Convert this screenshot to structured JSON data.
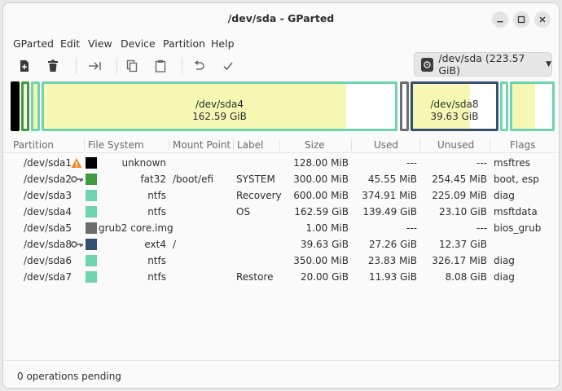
{
  "window": {
    "title": "/dev/sda - GParted"
  },
  "menu": [
    "GParted",
    "Edit",
    "View",
    "Device",
    "Partition",
    "Help"
  ],
  "toolbar": {
    "icons": [
      "new-partition-icon",
      "delete-icon",
      "resize-move-icon",
      "copy-icon",
      "paste-icon",
      "undo-icon",
      "apply-icon"
    ]
  },
  "device_selector": {
    "label": "/dev/sda (223.57 GiB)"
  },
  "disk_graph": {
    "sda4": {
      "line1": "/dev/sda4",
      "line2": "162.59 GiB"
    },
    "sda8": {
      "line1": "/dev/sda8",
      "line2": "39.63 GiB"
    }
  },
  "table": {
    "columns": [
      "Partition",
      "File System",
      "Mount Point",
      "Label",
      "Size",
      "Used",
      "Unused",
      "Flags"
    ],
    "rows": [
      {
        "partition": "/dev/sda1",
        "warning": true,
        "key": false,
        "color": "#000000",
        "filesystem": "unknown",
        "mount": "",
        "label": "",
        "size": "128.00 MiB",
        "used": "---",
        "unused": "---",
        "flags": "msftres"
      },
      {
        "partition": "/dev/sda2",
        "warning": false,
        "key": true,
        "color": "#3f9b3f",
        "filesystem": "fat32",
        "mount": "/boot/efi",
        "label": "SYSTEM",
        "size": "300.00 MiB",
        "used": "45.55 MiB",
        "unused": "254.45 MiB",
        "flags": "boot, esp"
      },
      {
        "partition": "/dev/sda3",
        "warning": false,
        "key": false,
        "color": "#6fd3b0",
        "filesystem": "ntfs",
        "mount": "",
        "label": "Recovery",
        "size": "600.00 MiB",
        "used": "374.91 MiB",
        "unused": "225.09 MiB",
        "flags": "diag"
      },
      {
        "partition": "/dev/sda4",
        "warning": false,
        "key": false,
        "color": "#6fd3b0",
        "filesystem": "ntfs",
        "mount": "",
        "label": "OS",
        "size": "162.59 GiB",
        "used": "139.49 GiB",
        "unused": "23.10 GiB",
        "flags": "msftdata"
      },
      {
        "partition": "/dev/sda5",
        "warning": false,
        "key": false,
        "color": "#6d6d6d",
        "filesystem": "grub2 core.img",
        "mount": "",
        "label": "",
        "size": "1.00 MiB",
        "used": "---",
        "unused": "---",
        "flags": "bios_grub"
      },
      {
        "partition": "/dev/sda8",
        "warning": false,
        "key": true,
        "color": "#34506e",
        "filesystem": "ext4",
        "mount": "/",
        "label": "",
        "size": "39.63 GiB",
        "used": "27.26 GiB",
        "unused": "12.37 GiB",
        "flags": ""
      },
      {
        "partition": "/dev/sda6",
        "warning": false,
        "key": false,
        "color": "#6fd3b0",
        "filesystem": "ntfs",
        "mount": "",
        "label": "",
        "size": "350.00 MiB",
        "used": "23.83 MiB",
        "unused": "326.17 MiB",
        "flags": "diag"
      },
      {
        "partition": "/dev/sda7",
        "warning": false,
        "key": false,
        "color": "#6fd3b0",
        "filesystem": "ntfs",
        "mount": "",
        "label": "Restore",
        "size": "20.00 GiB",
        "used": "11.93 GiB",
        "unused": "8.08 GiB",
        "flags": "diag"
      }
    ]
  },
  "status": {
    "text": "0 operations pending"
  },
  "colors": {
    "ntfs": "#6fd3b0",
    "used_fill": "#f7f7b4",
    "ext4": "#34506e",
    "fat32": "#3f9b3f",
    "unknown": "#000000",
    "grub": "#6d6d6d"
  }
}
